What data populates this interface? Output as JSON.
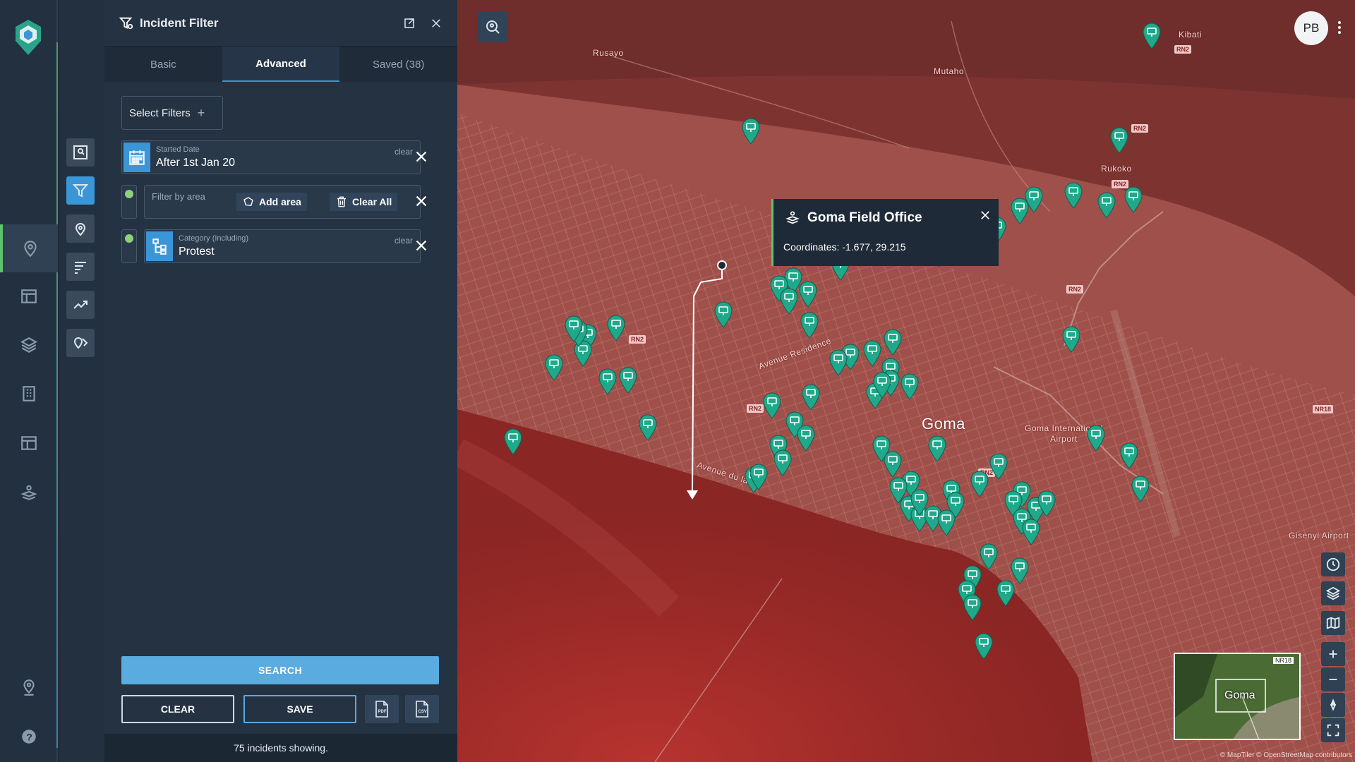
{
  "panel": {
    "title": "Incident Filter",
    "tabs": [
      {
        "label": "Basic",
        "active": false
      },
      {
        "label": "Advanced",
        "active": true
      },
      {
        "label": "Saved (38)",
        "active": false
      }
    ],
    "select_filters": "Select Filters",
    "select_filters_plus": "+",
    "filters": {
      "date": {
        "label": "Started Date",
        "value": "After 1st Jan 20",
        "clear": "clear"
      },
      "area": {
        "placeholder": "Filter by area",
        "add_area": "Add area",
        "clear_all": "Clear All"
      },
      "category": {
        "label": "Category (Including)",
        "value": "Protest",
        "clear": "clear"
      }
    },
    "search": "SEARCH",
    "clear": "CLEAR",
    "save": "SAVE",
    "export_pdf": "PDF",
    "export_csv": "CSV",
    "status": "75 incidents showing."
  },
  "user": {
    "initials": "PB"
  },
  "popup": {
    "title": "Goma Field Office",
    "coordinates": "Coordinates: -1.677, 29.215"
  },
  "map": {
    "labels": [
      {
        "text": "Rusayo"
      },
      {
        "text": "Mutaho"
      },
      {
        "text": "Kibati"
      },
      {
        "text": "Rukoko"
      },
      {
        "text": "Avenue Residence"
      },
      {
        "text": "Avenue du lac"
      },
      {
        "text": "Goma"
      },
      {
        "text": "Goma International"
      },
      {
        "text": "Airport"
      },
      {
        "text": "Gisenyi Airport"
      }
    ],
    "road_signs": [
      "RN2",
      "RN2",
      "RN2",
      "RN2",
      "RN2",
      "RN2",
      "RN2",
      "NR18"
    ],
    "minimap_label": "Goma",
    "minimap_badge": "NR18",
    "attribution": "© MapTiler © OpenStreetMap contributors",
    "colors": {
      "overlay": "#9b3a36",
      "marker": "#1fa889"
    }
  }
}
